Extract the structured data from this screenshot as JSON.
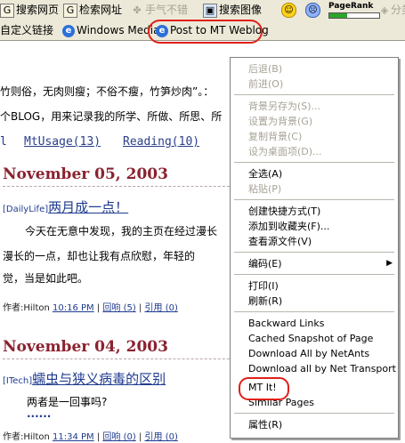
{
  "toolbar1": {
    "items": [
      {
        "label": "搜索网页",
        "icon": "search-web-icon"
      },
      {
        "label": "检索网址",
        "icon": "search-url-icon"
      },
      {
        "label": "手气不错",
        "icon": "clover-icon"
      },
      {
        "label": "搜索图像",
        "icon": "image-search-icon"
      }
    ],
    "pagerank_label": "PageRank",
    "pagerank_value": 0.35,
    "partial_label": "分类"
  },
  "toolbar2": {
    "items": [
      {
        "label": "自定义链接"
      },
      {
        "label": "Windows Media"
      },
      {
        "label": "Post to MT Weblog"
      }
    ]
  },
  "content": {
    "intro1": "竹则俗，无肉则瘦；不俗不瘦，竹笋炒肉”。：",
    "intro2": "个BLOG，用来记录我的所学、所做、所思、所",
    "nav": [
      "MtUsage(13)",
      "Reading(10)"
    ],
    "posts": [
      {
        "date": "November 05, 2003",
        "category": "[DailyLife]",
        "title": "两月成一点！",
        "body": [
          "今天在无意中发现，我的主页在经过漫长",
          "漫长的一点，却也让我有点欣慰，年轻的",
          "觉，当是如此吧。"
        ],
        "author": "作者:Hilton",
        "time": "10:16 PM",
        "comments": "回响 (5)",
        "trackback": "引用 (0)"
      },
      {
        "date": "November 04, 2003",
        "category": "[ITech]",
        "title": "蠕虫与狭义病毒的区别",
        "body": [
          "两者是一回事吗?"
        ],
        "more": "......",
        "author": "作者:Hilton",
        "time": "11:34 PM",
        "comments": "回响 (0)",
        "trackback": "引用 (0)"
      }
    ],
    "separator": "|"
  },
  "menu": {
    "back": "后退(B)",
    "forward": "前进(O)",
    "save_bg": "背景另存为(S)...",
    "set_bg": "设置为背景(G)",
    "copy_bg": "复制背景(C)",
    "set_desktop": "设为桌面项(D)...",
    "select_all": "全选(A)",
    "paste": "粘贴(P)",
    "create_shortcut": "创建快捷方式(T)",
    "add_fav": "添加到收藏夹(F)...",
    "view_source": "查看源文件(V)",
    "encoding": "编码(E)",
    "print": "打印(I)",
    "refresh": "刷新(R)",
    "backward_links": "Backward Links",
    "cached_snapshot": "Cached Snapshot of Page",
    "download_netants": "Download All by NetAnts",
    "download_nettransport": "Download all by Net Transport",
    "mt_it": "MT It!",
    "similar_pages": "Similar Pages",
    "properties": "属性(R)"
  },
  "colors": {
    "highlight_ring": "#e0201a",
    "date": "#8a2230",
    "link": "#1f3b8f",
    "pagerank_fill": "#2da52d"
  }
}
